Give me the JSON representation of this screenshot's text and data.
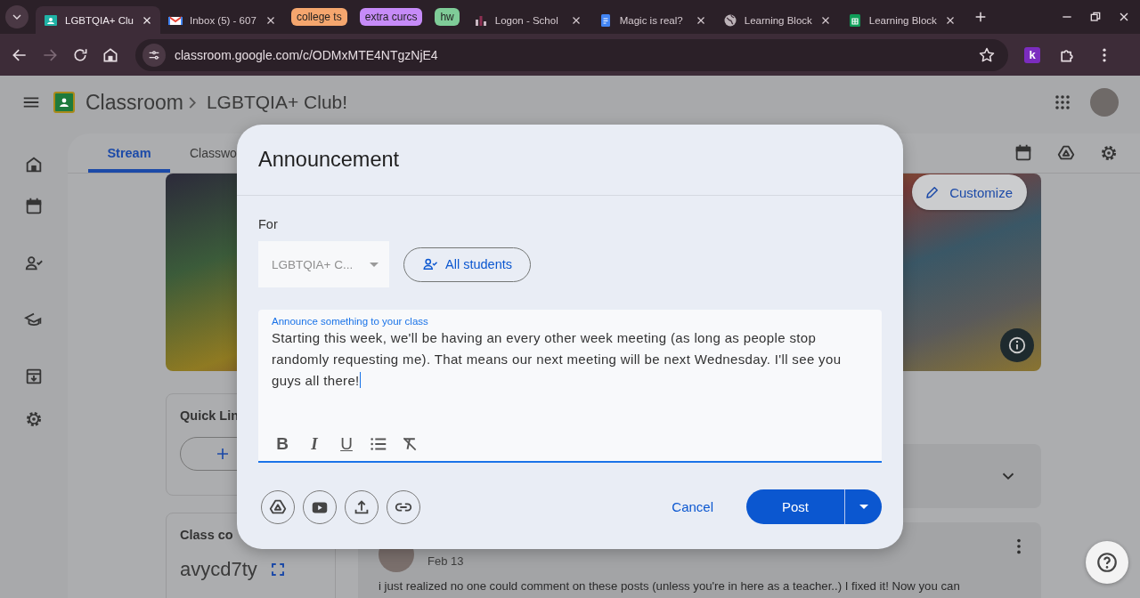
{
  "browser": {
    "tabs": [
      {
        "kind": "page",
        "title": "LGBTQIA+ Clu",
        "favicon": {
          "kind": "board"
        },
        "selected": true
      },
      {
        "kind": "page",
        "title": "Inbox (5) - 607",
        "favicon": {
          "kind": "envelope"
        },
        "selected": false
      },
      {
        "kind": "group",
        "title": "college ts",
        "color": "#f5a66e"
      },
      {
        "kind": "group",
        "title": "extra curcs",
        "color": "#c68bf8"
      },
      {
        "kind": "group",
        "title": "hw",
        "color": "#7fcc98"
      },
      {
        "kind": "page",
        "title": "Logon - Schol",
        "favicon": {
          "kind": "bars"
        },
        "selected": false
      },
      {
        "kind": "page",
        "title": "Magic is real?",
        "favicon": {
          "kind": "document"
        },
        "selected": false
      },
      {
        "kind": "page",
        "title": "Learning Block",
        "favicon": {
          "kind": "globe"
        },
        "selected": false
      },
      {
        "kind": "page",
        "title": "Learning Block",
        "favicon": {
          "kind": "sheet"
        },
        "selected": false
      }
    ],
    "url": "classroom.google.com/c/ODMxMTE4NTgzNjE4",
    "extension_badge": "k"
  },
  "header": {
    "app_name": "Classroom",
    "class_name": "LGBTQIA+ Club!"
  },
  "class_tabs": [
    {
      "label": "Stream",
      "selected": true
    },
    {
      "label": "Classwo",
      "selected": false
    }
  ],
  "banner": {
    "customize_button": "Customize"
  },
  "quick_links": {
    "title": "Quick Lin"
  },
  "class_code": {
    "title": "Class co",
    "code": "avycd7ty"
  },
  "post": {
    "date": "Feb 13",
    "text": "i just realized no one could comment on these posts (unless you're in here as a teacher..) I fixed it! Now you can"
  },
  "dialog": {
    "title": "Announcement",
    "for_label": "For",
    "class_select": "LGBTQIA+ C...",
    "recipients": "All students",
    "editor": {
      "label": "Announce something to your class",
      "value": "Starting this week, we'll be having an every other week meeting (as long as people stop randomly requesting me). That means our next meeting will be next Wednesday. I'll see you guys all there!"
    },
    "format_buttons": [
      {
        "kind": "bold",
        "label": "B"
      },
      {
        "kind": "italic",
        "label": "I"
      },
      {
        "kind": "underline",
        "label": "U"
      },
      {
        "kind": "list"
      },
      {
        "kind": "clear"
      }
    ],
    "attach_buttons": [
      {
        "kind": "drive"
      },
      {
        "kind": "video"
      },
      {
        "kind": "upload"
      },
      {
        "kind": "link"
      }
    ],
    "cancel_button": "Cancel",
    "post_button": "Post"
  }
}
